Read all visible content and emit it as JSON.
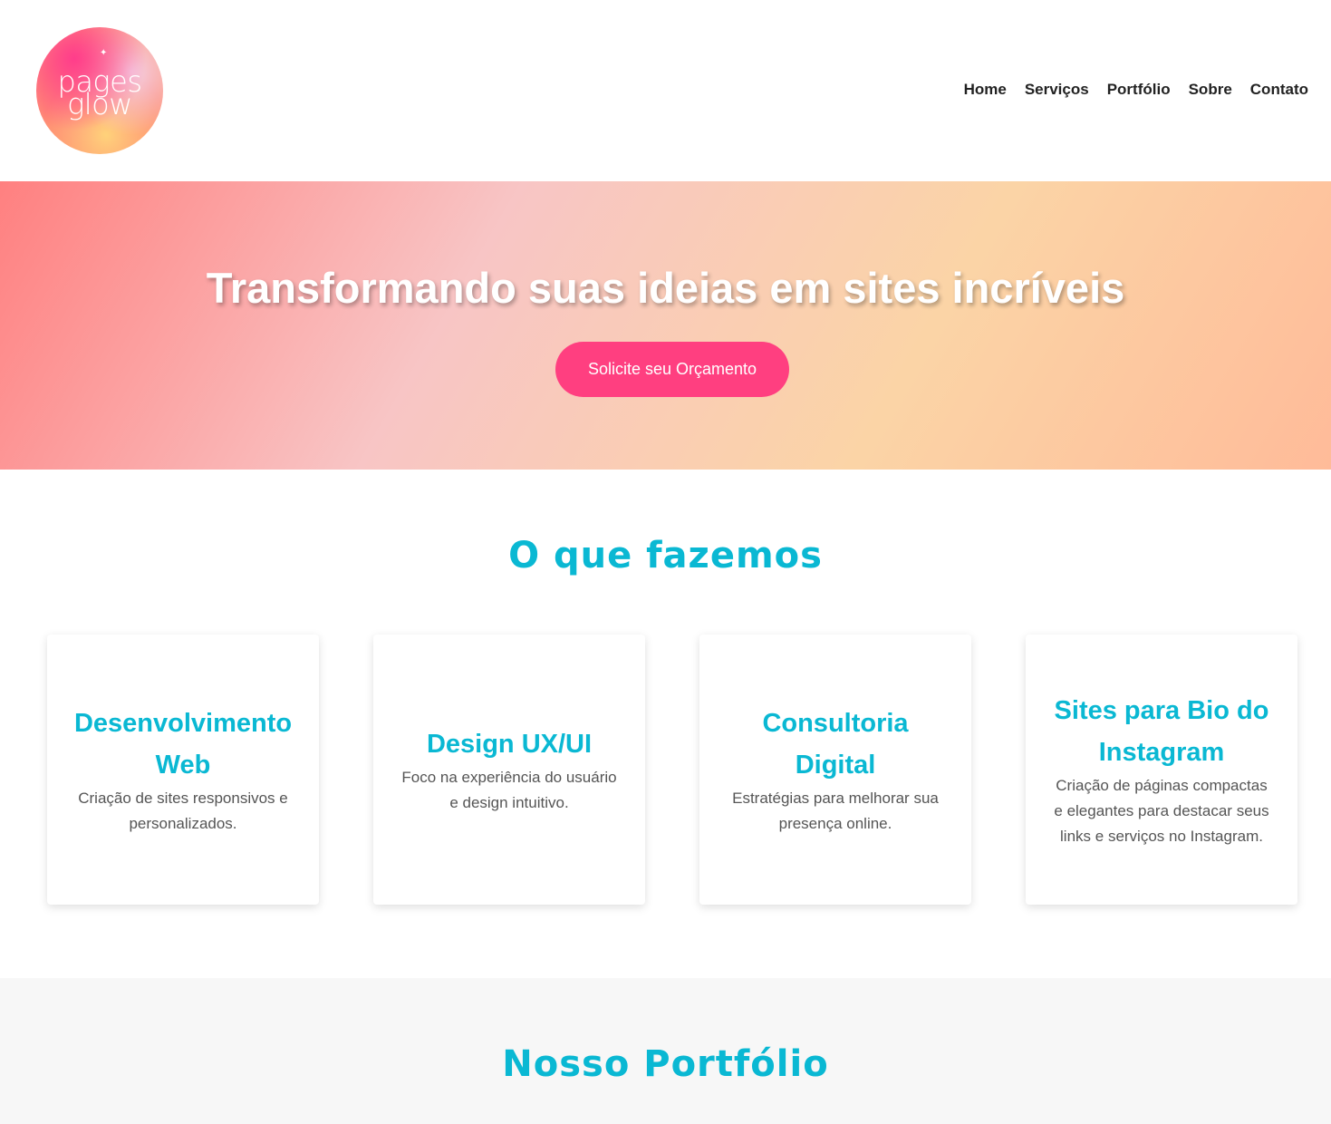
{
  "header": {
    "logo": {
      "line1": "pages",
      "line2": "glow",
      "sparkle": "✦"
    },
    "nav": [
      {
        "label": "Home"
      },
      {
        "label": "Serviços"
      },
      {
        "label": "Portfólio"
      },
      {
        "label": "Sobre"
      },
      {
        "label": "Contato"
      }
    ]
  },
  "hero": {
    "title": "Transformando suas ideias em sites incríveis",
    "cta_label": "Solicite seu Orçamento"
  },
  "services": {
    "title": "O que fazemos",
    "cards": [
      {
        "title": "Desenvolvimento Web",
        "description": "Criação de sites responsivos e personalizados."
      },
      {
        "title": "Design UX/UI",
        "description": "Foco na experiência do usuário e design intuitivo."
      },
      {
        "title": "Consultoria Digital",
        "description": "Estratégias para melhorar sua presença online."
      },
      {
        "title": "Sites para Bio do Instagram",
        "description": "Criação de páginas compactas e elegantes para destacar seus links e serviços no Instagram."
      }
    ]
  },
  "portfolio": {
    "title": "Nosso Portfólio"
  },
  "colors": {
    "accent": "#0ab8d3",
    "cta": "#ff3f80",
    "text_dark": "#222222",
    "text_body": "#555555",
    "section_alt_bg": "#f7f7f7"
  }
}
